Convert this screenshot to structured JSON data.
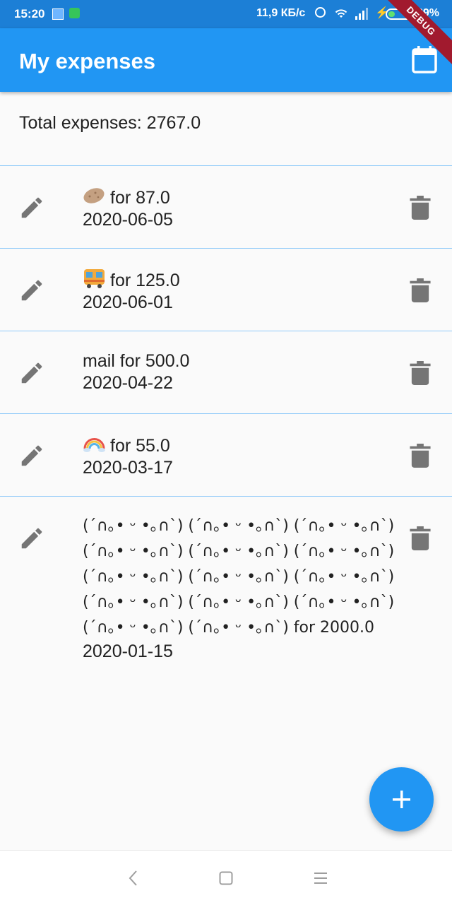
{
  "status_bar": {
    "time": "15:20",
    "network_speed": "11,9 КБ/с",
    "battery_percent": "29%",
    "battery_level": 0.29,
    "debug_label": "DEBUG"
  },
  "app_bar": {
    "title": "My expenses",
    "calendar_icon": "calendar-icon",
    "background_color": "#2196f3"
  },
  "summary": {
    "total_text": "Total expenses: 2767.0"
  },
  "expenses": [
    {
      "icon": "potato-emoji",
      "text": "for 87.0",
      "date": "2020-06-05"
    },
    {
      "icon": "bus-emoji",
      "text": "for 125.0",
      "date": "2020-06-01"
    },
    {
      "icon": "",
      "text": "mail for 500.0",
      "date": "2020-04-22"
    },
    {
      "icon": "rainbow-emoji",
      "text": "for 55.0",
      "date": "2020-03-17"
    },
    {
      "icon": "",
      "lines": [
        "(´∩｡• ᵕ •｡∩`) (´∩｡• ᵕ •｡∩`) (´∩｡• ᵕ •｡∩`)",
        "(´∩｡• ᵕ •｡∩`) (´∩｡• ᵕ •｡∩`) (´∩｡• ᵕ •｡∩`)",
        "(´∩｡• ᵕ •｡∩`) (´∩｡• ᵕ •｡∩`) (´∩｡• ᵕ •｡∩`)",
        "(´∩｡• ᵕ •｡∩`) (´∩｡• ᵕ •｡∩`) (´∩｡• ᵕ •｡∩`)",
        "(´∩｡• ᵕ •｡∩`) (´∩｡• ᵕ •｡∩`)  for 2000.0"
      ],
      "date": "2020-01-15"
    }
  ],
  "item_actions": {
    "edit_icon": "pencil-icon",
    "delete_icon": "trash-icon"
  },
  "fab": {
    "icon": "plus-icon"
  },
  "nav_bar": {
    "back_icon": "back-icon",
    "home_icon": "home-icon",
    "menu_icon": "menu-icon"
  }
}
